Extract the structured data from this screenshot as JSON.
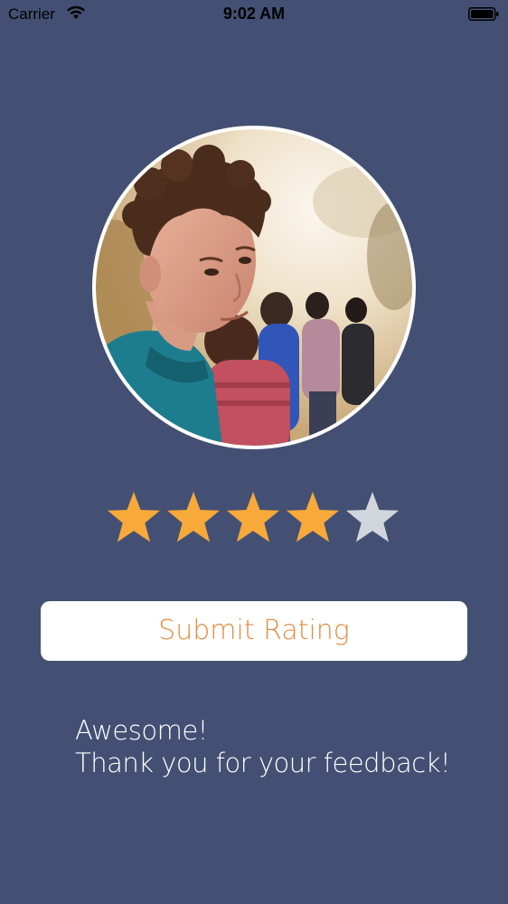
{
  "status_bar": {
    "carrier": "Carrier",
    "time": "9:02 AM",
    "wifi_icon": "wifi-icon",
    "battery_icon": "battery-icon"
  },
  "profile": {
    "avatar_icon": "profile-photo"
  },
  "rating": {
    "value": 4,
    "max": 5,
    "filled_color": "#f7a93a",
    "empty_color": "#d1d5dc"
  },
  "submit_button": {
    "label": "Submit Rating",
    "text_color": "#e38d44"
  },
  "feedback": {
    "line1": "Awesome!",
    "line2": "Thank you for your feedback!"
  },
  "colors": {
    "background": "#435073",
    "button_background": "#ffffff"
  }
}
